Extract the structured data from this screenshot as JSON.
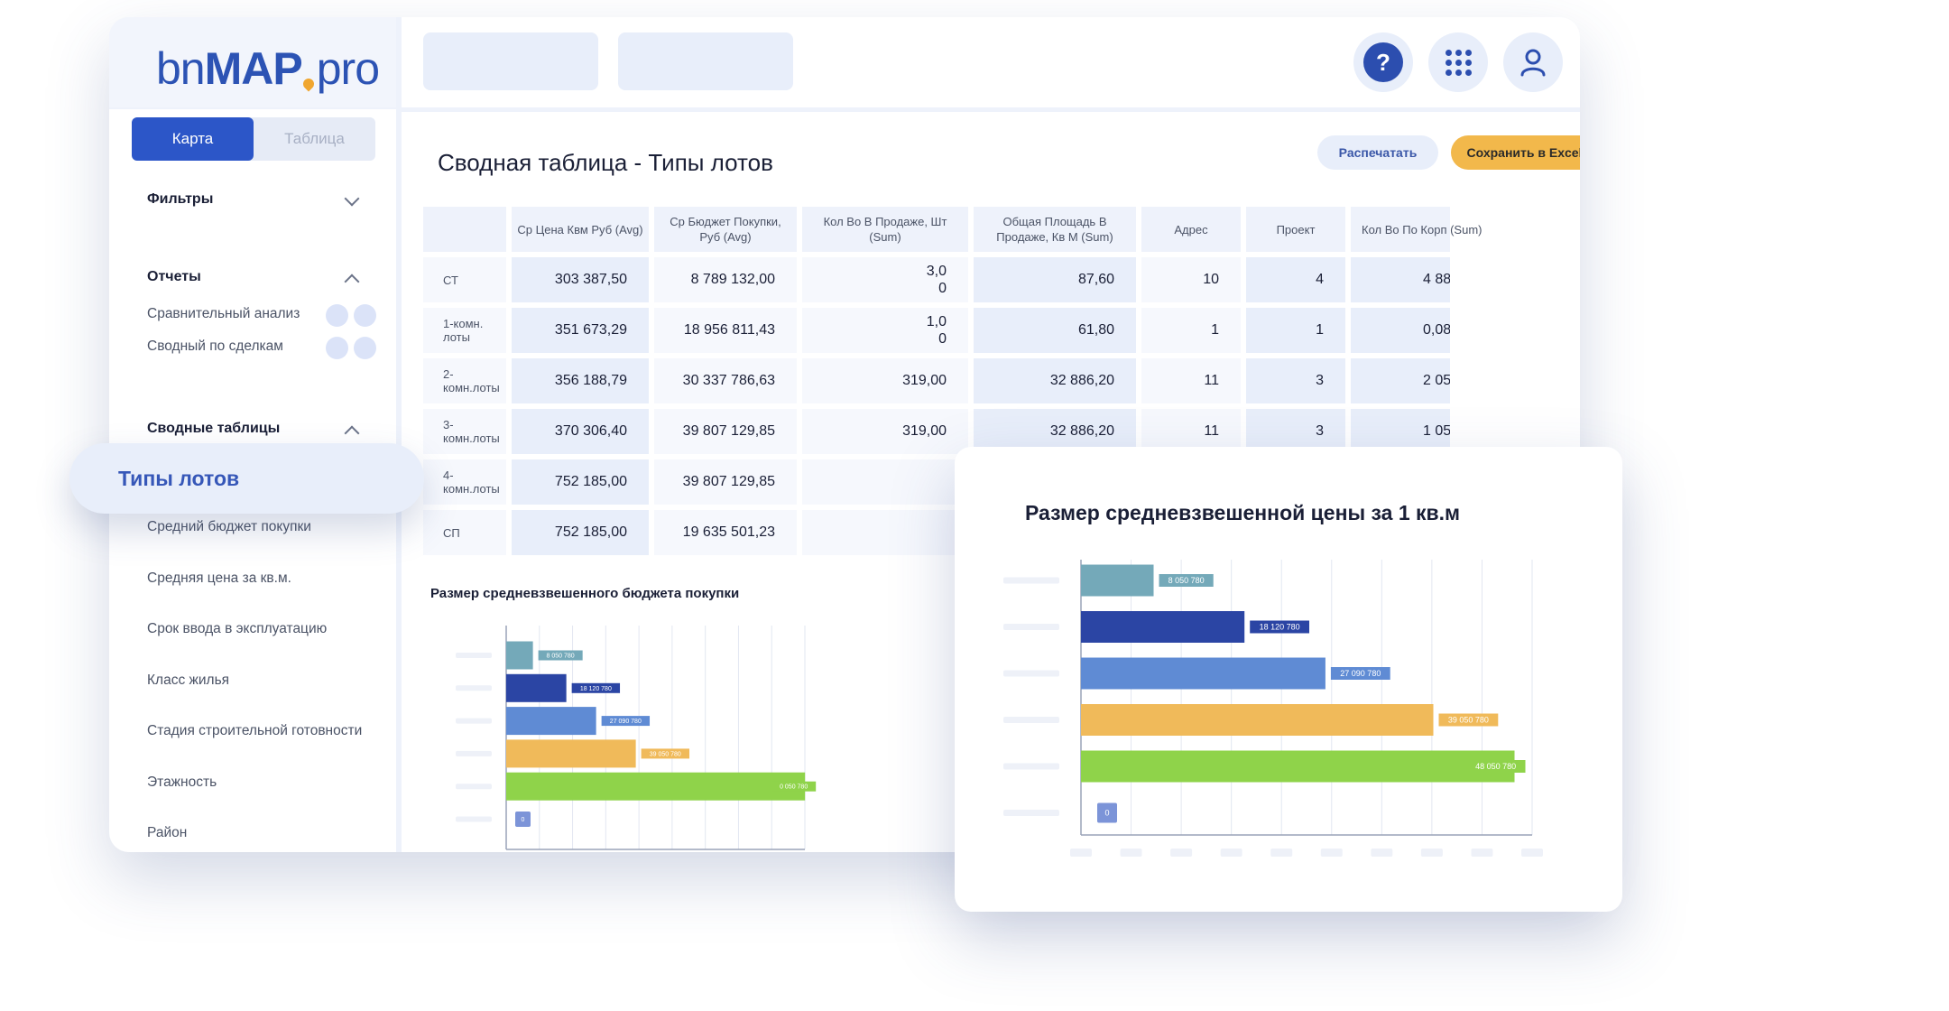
{
  "app": {
    "logo": {
      "part1": "bn",
      "part2": "MAP",
      "part3": "pro"
    },
    "help_label": "?"
  },
  "sidebar": {
    "view_tabs": [
      "Карта",
      "Таблица"
    ],
    "active_tab": "Карта",
    "filters_title": "Фильтры",
    "reports_title": "Отчеты",
    "reports": [
      "Сравнительный анализ",
      "Сводный по сделкам"
    ],
    "pivot_title": "Сводные таблицы",
    "pivot_items": [
      "Типы лотов",
      "Средний бюджет покупки",
      "Средняя цена за кв.м.",
      "Срок ввода в эксплуатацию",
      "Класс жилья",
      "Стадия строительной готовности",
      "Этажность",
      "Район"
    ],
    "selected_item": "Типы лотов"
  },
  "main": {
    "title": "Сводная таблица - Типы лотов",
    "print_button": "Распечатать",
    "excel_button": "Сохранить в Excel",
    "table": {
      "headers": [
        "",
        "Ср Цена Квм Руб (Avg)",
        "Ср Бюджет Покупки, Руб (Avg)",
        "Кол Во В Продаже, Шт (Sum)",
        "Общая Площадь В Продаже, Кв М (Sum)",
        "Адрес",
        "Проект",
        "Кол Во По Корп (Sum)"
      ],
      "rows": [
        [
          "СТ",
          "303 387,50",
          "8 789 132,00",
          "3,0\n0",
          "87,60",
          "10",
          "4",
          "4 88"
        ],
        [
          "1-комн. лоты",
          "351 673,29",
          "18 956 811,43",
          "1,0\n0",
          "61,80",
          "1",
          "1",
          "0,08"
        ],
        [
          "2-комн.лоты",
          "356 188,79",
          "30 337 786,63",
          "319,00",
          "32 886,20",
          "11",
          "3",
          "2 05"
        ],
        [
          "3-комн.лоты",
          "370 306,40",
          "39 807 129,85",
          "319,00",
          "32 886,20",
          "11",
          "3",
          "1 05"
        ],
        [
          "4-комн.лоты",
          "752 185,00",
          "39 807 129,85",
          "",
          "",
          "",
          "",
          ""
        ],
        [
          "СП",
          "752 185,00",
          "19 635 501,23",
          "",
          "",
          "",
          "",
          ""
        ]
      ]
    }
  },
  "chart_data": [
    {
      "type": "bar",
      "title": "Размер средневзвешенного бюджета покупки",
      "categories": [
        "",
        "",
        "",
        "",
        "",
        ""
      ],
      "values": [
        8050780,
        18120780,
        27090780,
        39050780,
        90050780,
        0
      ],
      "data_labels": [
        "8 050 780",
        "18 120 780",
        "27 090 780",
        "39 050 780",
        "0 050 780",
        "0"
      ],
      "colors": [
        "#74a9b9",
        "#2b45a4",
        "#5f8bd4",
        "#f0ba5a",
        "#8fd34a",
        "#7c94d8"
      ],
      "xlim": [
        0,
        90000000
      ],
      "grid": true
    },
    {
      "type": "bar",
      "title": "Размер средневзвешенной цены за 1 кв.м",
      "categories": [
        "",
        "",
        "",
        "",
        "",
        ""
      ],
      "values": [
        8050780,
        18120780,
        27090780,
        39050780,
        48050780,
        0
      ],
      "data_labels": [
        "8 050 780",
        "18 120 780",
        "27 090 780",
        "39 050 780",
        "48 050 780",
        "0"
      ],
      "colors": [
        "#74a9b9",
        "#2b45a4",
        "#5f8bd4",
        "#f0ba5a",
        "#8fd34a",
        "#7c94d8"
      ],
      "xlim": [
        0,
        50000000
      ],
      "grid": true
    }
  ]
}
